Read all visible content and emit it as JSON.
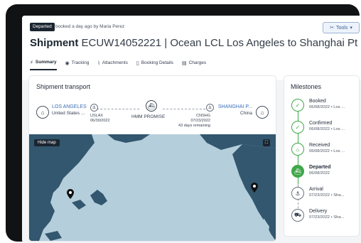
{
  "header": {
    "status_badge": "Departed",
    "booked_by": "booked a day ago by Maria Perez",
    "tools_label": "Tools",
    "title_prefix": "Shipment",
    "shipment_id": "ECUW14052221",
    "title_suffix": "| Ocean LCL Los Angeles to Shanghai Pt"
  },
  "tabs": [
    {
      "label": "Summary",
      "icon": "summary-icon"
    },
    {
      "label": "Tracking",
      "icon": "tracking-icon"
    },
    {
      "label": "Attachments",
      "icon": "paperclip-icon"
    },
    {
      "label": "Booking Details",
      "icon": "document-icon"
    },
    {
      "label": "Charges",
      "icon": "invoice-icon"
    }
  ],
  "transport": {
    "title": "Shipment transport",
    "origin": {
      "name": "LOS ANGELES",
      "country": "United States ...",
      "code": "USLAX",
      "date": "06/30/2022"
    },
    "vessel": "HMM PROMISE",
    "destination": {
      "name": "SHANGHAI P...",
      "country": "China",
      "code": "CNSHG",
      "date": "07/23/2022",
      "remaining": "43 days remaining"
    },
    "hide_map": "Hide map"
  },
  "milestones": {
    "title": "Milestones",
    "items": [
      {
        "name": "Booked",
        "date": "06/08/2022 • Los ...",
        "state": "done",
        "icon": "calendar-check-icon"
      },
      {
        "name": "Confirmed",
        "date": "06/08/2022 • Los ...",
        "state": "done",
        "icon": "clipboard-check-icon"
      },
      {
        "name": "Received",
        "date": "06/08/2022 • Los ...",
        "state": "done",
        "icon": "warehouse-icon"
      },
      {
        "name": "Departed",
        "date": "06/08/2022",
        "state": "current",
        "icon": "ship-icon"
      },
      {
        "name": "Arrival",
        "date": "07/23/2022 • Sha...",
        "state": "future",
        "icon": "anchor-icon"
      },
      {
        "name": "Delivery",
        "date": "07/23/2022 • Sha...",
        "state": "future",
        "icon": "truck-icon"
      }
    ]
  },
  "colors": {
    "accent_green": "#3fa74a",
    "dark": "#1b2530",
    "link_blue": "#3b6fb6",
    "ocean": "#b5cedb",
    "land": "#32576e"
  }
}
